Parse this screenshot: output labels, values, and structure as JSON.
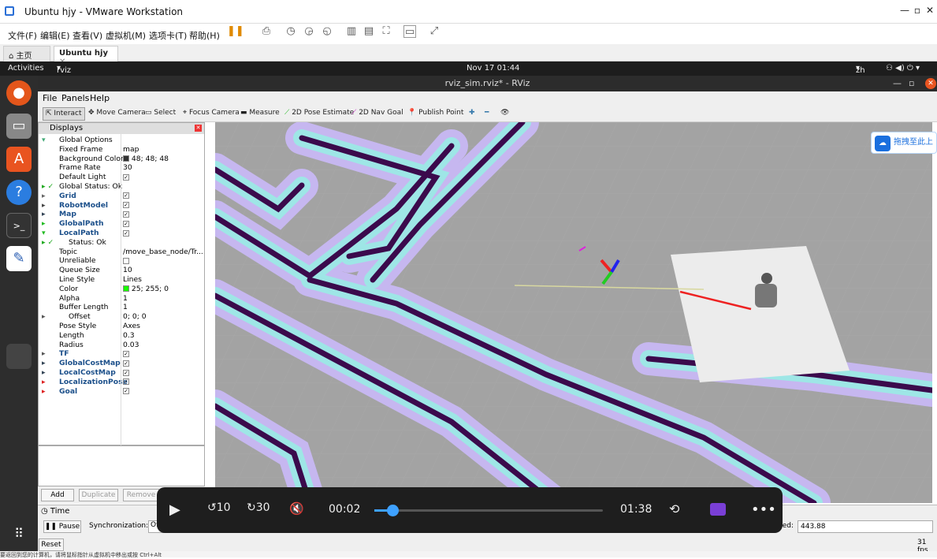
{
  "vm": {
    "title": "Ubuntu hjy - VMware Workstation",
    "menu": [
      "文件(F)",
      "编辑(E)",
      "查看(V)",
      "虚拟机(M)",
      "选项卡(T)",
      "帮助(H)"
    ],
    "tabs": [
      "主页",
      "Ubuntu hjy"
    ]
  },
  "gnome": {
    "activities": "Activities",
    "app": "rviz",
    "clock": "Nov 17  01:44",
    "lang": "zh"
  },
  "rviz": {
    "title": "rviz_sim.rviz* - RViz",
    "menu": [
      "File",
      "Panels",
      "Help"
    ],
    "tools": [
      "Interact",
      "Move Camera",
      "Select",
      "Focus Camera",
      "Measure",
      "2D Pose Estimate",
      "2D Nav Goal",
      "Publish Point"
    ],
    "displays_title": "Displays",
    "rows": [
      {
        "k": "Global Options",
        "v": ""
      },
      {
        "k": "Fixed Frame",
        "v": "map"
      },
      {
        "k": "Background Color",
        "v": "48; 48; 48"
      },
      {
        "k": "Frame Rate",
        "v": "30"
      },
      {
        "k": "Default Light",
        "v": "✓"
      },
      {
        "k": "Global Status: Ok",
        "v": ""
      },
      {
        "k": "Grid",
        "v": "✓"
      },
      {
        "k": "RobotModel",
        "v": "✓"
      },
      {
        "k": "Map",
        "v": "✓"
      },
      {
        "k": "GlobalPath",
        "v": "✓"
      },
      {
        "k": "LocalPath",
        "v": "✓"
      },
      {
        "k": "Status: Ok",
        "v": ""
      },
      {
        "k": "Topic",
        "v": "/move_base_node/Tr..."
      },
      {
        "k": "Unreliable",
        "v": ""
      },
      {
        "k": "Queue Size",
        "v": "10"
      },
      {
        "k": "Line Style",
        "v": "Lines"
      },
      {
        "k": "Color",
        "v": "25; 255; 0"
      },
      {
        "k": "Alpha",
        "v": "1"
      },
      {
        "k": "Buffer Length",
        "v": "1"
      },
      {
        "k": "Offset",
        "v": "0; 0; 0"
      },
      {
        "k": "Pose Style",
        "v": "Axes"
      },
      {
        "k": "Length",
        "v": "0.3"
      },
      {
        "k": "Radius",
        "v": "0.03"
      },
      {
        "k": "TF",
        "v": "✓"
      },
      {
        "k": "GlobalCostMap",
        "v": "✓"
      },
      {
        "k": "LocalCostMap",
        "v": "✓"
      },
      {
        "k": "LocalizationPose",
        "v": "✓"
      },
      {
        "k": "Goal",
        "v": "✓"
      }
    ],
    "buttons": {
      "add": "Add",
      "duplicate": "Duplicate",
      "remove": "Remove"
    },
    "time": {
      "title": "Time",
      "pause": "Pause",
      "sync": "Synchronization:",
      "sync_val": "Of",
      "elapsed_label": "sed:",
      "elapsed": "443.88",
      "reset": "Reset",
      "fps": "31 fps"
    }
  },
  "player": {
    "current": "00:02",
    "total": "01:38",
    "progress": 0.02,
    "skip_back": "10",
    "skip_fwd": "30"
  },
  "overlay": {
    "baidu": "拖拽至此上"
  },
  "status": "要返回到您的计算机，请将鼠标指针从虚拟机中移出或按 Ctrl+Alt"
}
